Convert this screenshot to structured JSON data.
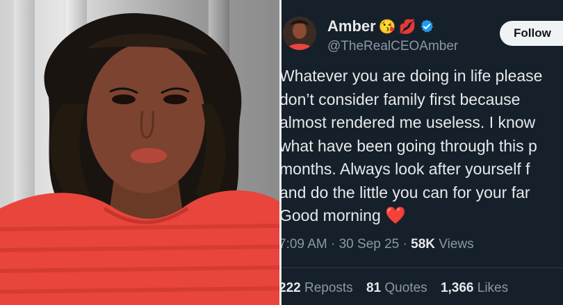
{
  "tweet": {
    "display_name": "Amber",
    "emojis": [
      "😘",
      "💋"
    ],
    "handle": "@TheRealCEOAmber",
    "follow_label": "Follow",
    "lines": [
      "Whatever you are doing in life please",
      "don’t consider family first because",
      "almost rendered me useless. I know",
      "what have been going through this p",
      "months. Always look after yourself f",
      "and do the little you can for your far",
      "Good morning"
    ],
    "heart_emoji": "❤️",
    "time": "7:09 AM",
    "date": "30 Sep 25",
    "views_count": "58K",
    "views_label": "Views",
    "reposts_count": "222",
    "reposts_label": "Reposts",
    "quotes_count": "81",
    "quotes_label": "Quotes",
    "likes_count": "1,366",
    "likes_label": "Likes",
    "separator": "·"
  },
  "colors": {
    "background": "#15202b",
    "text": "#e7e9ea",
    "muted": "#8b98a5",
    "verified": "#1d9bf0",
    "heart": "#f4212e",
    "dress": "#e8453c"
  },
  "icons": [
    "verified-badge-icon"
  ]
}
